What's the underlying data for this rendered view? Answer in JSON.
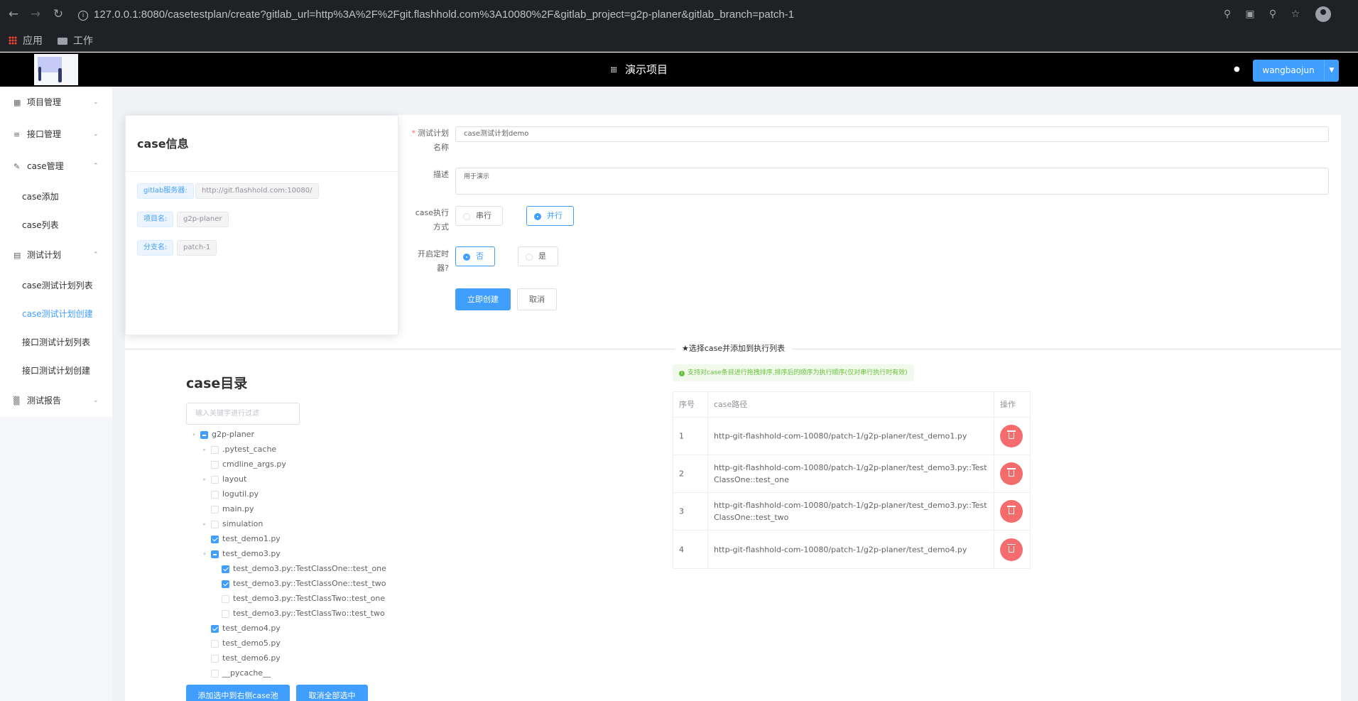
{
  "browser": {
    "url": "127.0.0.1:8080/casetestplan/create?gitlab_url=http%3A%2F%2Fgit.flashhold.com%3A10080%2F&gitlab_project=g2p-planer&gitlab_branch=patch-1",
    "bookmarks": [
      "应用",
      "工作"
    ]
  },
  "header": {
    "project_title": "演示项目",
    "user_name": "wangbaojun"
  },
  "sidebar": {
    "groups": [
      {
        "label": "项目管理",
        "icon": "grid-icon"
      },
      {
        "label": "接口管理",
        "icon": "list-icon"
      },
      {
        "label": "case管理",
        "icon": "edit-icon",
        "items": [
          "case添加",
          "case列表"
        ]
      },
      {
        "label": "测试计划",
        "icon": "document-icon",
        "items": [
          "case测试计划列表",
          "case测试计划创建",
          "接口测试计划列表",
          "接口测试计划创建"
        ]
      },
      {
        "label": "测试报告",
        "icon": "bar-chart-icon"
      }
    ],
    "active_item": "case测试计划创建"
  },
  "info_card": {
    "title": "case信息",
    "rows": [
      {
        "label": "gitlab服务器:",
        "value": "http://git.flashhold.com:10080/"
      },
      {
        "label": "项目名:",
        "value": "g2p-planer"
      },
      {
        "label": "分支名:",
        "value": "patch-1"
      }
    ]
  },
  "form": {
    "name_label_1": "测试计划",
    "name_label_2": "名称",
    "name_value": "case测试计划demo",
    "desc_label": "描述",
    "desc_value": "用于演示",
    "mode_label_1": "case执行",
    "mode_label_2": "方式",
    "mode_options": [
      "串行",
      "并行"
    ],
    "mode_selected": "并行",
    "timer_label_1": "开启定时",
    "timer_label_2": "器?",
    "timer_options": [
      "否",
      "是"
    ],
    "timer_selected": "否",
    "submit_label": "立即创建",
    "cancel_label": "取消"
  },
  "section_title": "★选择case并添加到执行列表",
  "tree": {
    "title": "case目录",
    "filter_placeholder": "输入关键字进行过滤",
    "nodes": [
      {
        "label": "g2p-planer",
        "level": 0,
        "expand": "open",
        "state": "indeterminate"
      },
      {
        "label": ".pytest_cache",
        "level": 1,
        "expand": "closed",
        "state": "unchecked"
      },
      {
        "label": "cmdline_args.py",
        "level": 1,
        "expand": "none",
        "state": "unchecked"
      },
      {
        "label": "layout",
        "level": 1,
        "expand": "closed",
        "state": "unchecked"
      },
      {
        "label": "logutil.py",
        "level": 1,
        "expand": "none",
        "state": "unchecked"
      },
      {
        "label": "main.py",
        "level": 1,
        "expand": "none",
        "state": "unchecked"
      },
      {
        "label": "simulation",
        "level": 1,
        "expand": "closed",
        "state": "unchecked"
      },
      {
        "label": "test_demo1.py",
        "level": 1,
        "expand": "none",
        "state": "checked"
      },
      {
        "label": "test_demo3.py",
        "level": 1,
        "expand": "open",
        "state": "indeterminate"
      },
      {
        "label": "test_demo3.py::TestClassOne::test_one",
        "level": 2,
        "expand": "none",
        "state": "checked"
      },
      {
        "label": "test_demo3.py::TestClassOne::test_two",
        "level": 2,
        "expand": "none",
        "state": "checked"
      },
      {
        "label": "test_demo3.py::TestClassTwo::test_one",
        "level": 2,
        "expand": "none",
        "state": "unchecked"
      },
      {
        "label": "test_demo3.py::TestClassTwo::test_two",
        "level": 2,
        "expand": "none",
        "state": "unchecked"
      },
      {
        "label": "test_demo4.py",
        "level": 1,
        "expand": "none",
        "state": "checked"
      },
      {
        "label": "test_demo5.py",
        "level": 1,
        "expand": "none",
        "state": "unchecked"
      },
      {
        "label": "test_demo6.py",
        "level": 1,
        "expand": "none",
        "state": "unchecked"
      },
      {
        "label": "__pycache__",
        "level": 1,
        "expand": "none",
        "state": "unchecked"
      }
    ],
    "add_button": "添加选中到右侧case池",
    "clear_button": "取消全部选中"
  },
  "case_pool": {
    "tip": "支持对case条目进行拖拽排序,排序后的顺序为执行顺序(仅对串行执行时有效)",
    "headers": [
      "序号",
      "case路径",
      "操作"
    ],
    "rows": [
      {
        "index": "1",
        "path": "http-git-flashhold-com-10080/patch-1/g2p-planer/test_demo1.py"
      },
      {
        "index": "2",
        "path": "http-git-flashhold-com-10080/patch-1/g2p-planer/test_demo3.py::TestClassOne::test_one"
      },
      {
        "index": "3",
        "path": "http-git-flashhold-com-10080/patch-1/g2p-planer/test_demo3.py::TestClassOne::test_two"
      },
      {
        "index": "4",
        "path": "http-git-flashhold-com-10080/patch-1/g2p-planer/test_demo4.py"
      }
    ]
  },
  "colors": {
    "primary": "#409eff",
    "danger": "#f56c6c",
    "success": "#67c23a",
    "header_bg": "#000000"
  }
}
